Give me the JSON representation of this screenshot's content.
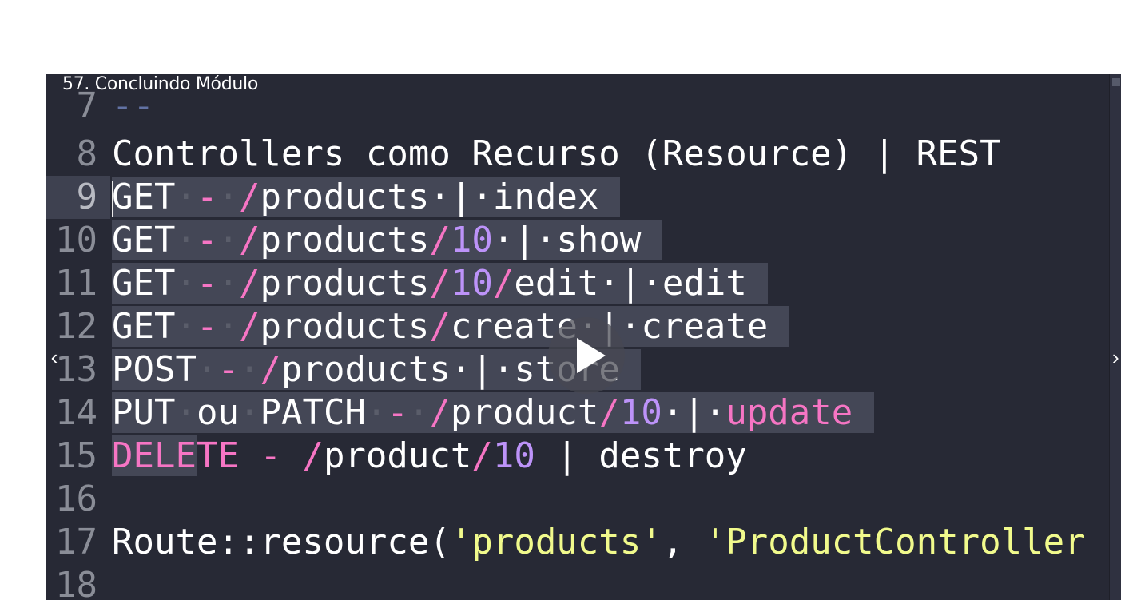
{
  "video": {
    "title": "57. Concluindo Módulo"
  },
  "nav": {
    "prev_icon": "chevron-left-icon",
    "next_icon": "chevron-right-icon",
    "prev_glyph": "‹",
    "next_glyph": "›"
  },
  "play_icon": "play-icon",
  "editor": {
    "line_numbers": [
      "7",
      "8",
      "9",
      "10",
      "11",
      "12",
      "13",
      "14",
      "15",
      "16",
      "17",
      "18"
    ],
    "active_line": "9",
    "lines": {
      "l7": {
        "a": "--"
      },
      "l8": {
        "a": "Controllers como Recurso (Resource) | REST"
      },
      "l9": {
        "a": "GET",
        "b": "·",
        "c": "-",
        "d": "·",
        "e": "/",
        "f": "products",
        "g": "·|·",
        "h": "index"
      },
      "l10": {
        "a": "GET",
        "b": "·",
        "c": "-",
        "d": "·",
        "e": "/",
        "f": "products",
        "g": "/",
        "h": "10",
        "i": "·|·",
        "j": "show"
      },
      "l11": {
        "a": "GET",
        "b": "·",
        "c": "-",
        "d": "·",
        "e": "/",
        "f": "products",
        "g": "/",
        "h": "10",
        "i": "/",
        "j": "edit",
        "k": "·|·",
        "l": "edit"
      },
      "l12": {
        "a": "GET",
        "b": "·",
        "c": "-",
        "d": "·",
        "e": "/",
        "f": "products",
        "g": "/",
        "h": "create",
        "i": "·|·",
        "j": "create"
      },
      "l13": {
        "a": "POST",
        "b": "·",
        "c": "-",
        "d": "·",
        "e": "/",
        "f": "products",
        "g": "·|·",
        "h": "store"
      },
      "l14": {
        "a": "PUT",
        "b": "·",
        "c": "ou",
        "d": "·",
        "e": "PATCH",
        "f": "·",
        "g": "-",
        "h": "·",
        "i": "/",
        "j": "product",
        "k": "/",
        "l": "10",
        "m": "·|·",
        "n": "update"
      },
      "l15": {
        "a": "DELE",
        "b": "TE",
        "c": " ",
        "d": "-",
        "e": " ",
        "f": "/",
        "g": "product",
        "h": "/",
        "i": "10",
        "j": " | ",
        "k": "destroy"
      },
      "l16": {},
      "l17": {
        "a": "Route::",
        "b": "resource(",
        "c": "'products'",
        "d": ", ",
        "e": "'ProductController"
      },
      "l18": {}
    }
  }
}
